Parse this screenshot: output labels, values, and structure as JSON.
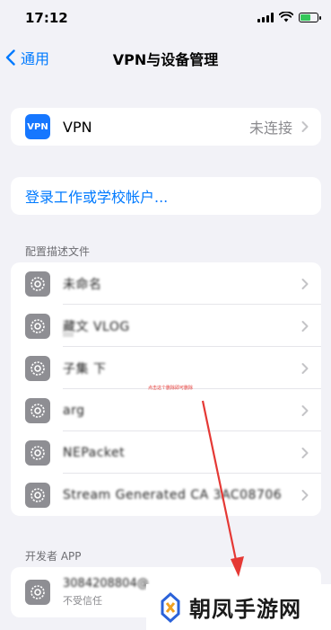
{
  "status_bar": {
    "time": "17:12",
    "battery_level": 0.7
  },
  "nav": {
    "back_label": "通用",
    "title": "VPN与设备管理"
  },
  "vpn": {
    "label": "VPN",
    "icon_text": "VPN",
    "value": "未连接"
  },
  "account": {
    "link_label": "登录工作或学校帐户..."
  },
  "profiles": {
    "header": "配置描述文件",
    "items": [
      {
        "label": "未命名"
      },
      {
        "label": "藏文 VLOG"
      },
      {
        "label": "子集 下"
      },
      {
        "label": "arg"
      },
      {
        "label": "NEPacket"
      },
      {
        "label": "Stream Generated CA 3AC08706"
      }
    ]
  },
  "developer": {
    "header": "开发者 APP",
    "item_title": "3084208804@_____",
    "item_sub": "不受信任"
  },
  "annotation": {
    "text": "点击这个删除即可删除"
  },
  "watermark": {
    "text": "朝凤手游网"
  },
  "colors": {
    "accent": "#007aff",
    "background": "#f2f2f7",
    "arrow": "#e53935"
  }
}
